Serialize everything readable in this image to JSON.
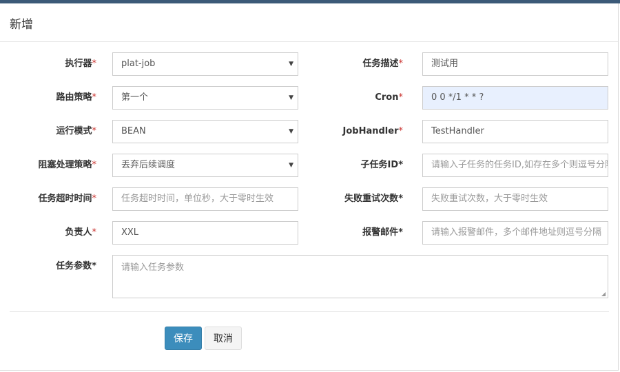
{
  "modal": {
    "title": "新增"
  },
  "form": {
    "executor": {
      "label": "执行器",
      "value": "plat-job"
    },
    "route_strategy": {
      "label": "路由策略",
      "value": "第一个"
    },
    "run_mode": {
      "label": "运行模式",
      "value": "BEAN"
    },
    "block_strategy": {
      "label": "阻塞处理策略",
      "value": "丢弃后续调度"
    },
    "timeout": {
      "label": "任务超时时间",
      "placeholder": "任务超时时间，单位秒，大于零时生效"
    },
    "author": {
      "label": "负责人",
      "value": "XXL"
    },
    "task_desc": {
      "label": "任务描述",
      "value": "测试用"
    },
    "cron": {
      "label": "Cron",
      "value": "0 0 */1 * * ?"
    },
    "job_handler": {
      "label": "JobHandler",
      "value": "TestHandler"
    },
    "child_job_id": {
      "label": "子任务ID",
      "placeholder": "请输入子任务的任务ID,如存在多个则逗号分隔"
    },
    "fail_retry": {
      "label": "失败重试次数",
      "placeholder": "失败重试次数，大于零时生效"
    },
    "alarm_email": {
      "label": "报警邮件",
      "placeholder": "请输入报警邮件，多个邮件地址则逗号分隔"
    },
    "task_param": {
      "label": "任务参数",
      "placeholder": "请输入任务参数"
    },
    "required_mark": "*"
  },
  "buttons": {
    "save": "保存",
    "cancel": "取消"
  },
  "colors": {
    "primary": "#3c8dbc",
    "required": "#c9302c",
    "highlight_bg": "#e8f0fe"
  }
}
